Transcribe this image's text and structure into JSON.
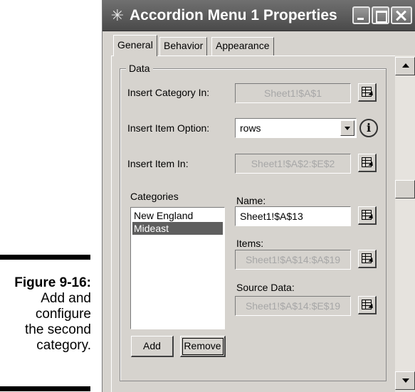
{
  "caption": {
    "figure": "Figure 9-16:",
    "lines": [
      "Add and",
      "configure",
      "the second",
      "category."
    ]
  },
  "window": {
    "title": "Accordion Menu 1 Properties",
    "controls": [
      "minimize-icon",
      "maximize-icon",
      "close-icon"
    ]
  },
  "tabs": [
    {
      "label": "General",
      "active": true
    },
    {
      "label": "Behavior",
      "active": false
    },
    {
      "label": "Appearance",
      "active": false
    }
  ],
  "data_group": {
    "legend": "Data",
    "insert_category_in": {
      "label": "Insert Category In:",
      "value": "Sheet1!$A$1"
    },
    "insert_item_option": {
      "label": "Insert Item Option:",
      "value": "rows"
    },
    "insert_item_in": {
      "label": "Insert Item In:",
      "value": "Sheet1!$A$2:$E$2"
    }
  },
  "categories": {
    "label": "Categories",
    "items": [
      {
        "label": "New England",
        "selected": false
      },
      {
        "label": "Mideast",
        "selected": true
      }
    ],
    "add_button": "Add",
    "remove_button": "Remove"
  },
  "details": {
    "name": {
      "label": "Name:",
      "value": "Sheet1!$A$13"
    },
    "items": {
      "label": "Items:",
      "value": "Sheet1!$A$14:$A$19"
    },
    "source_data": {
      "label": "Source Data:",
      "value": "Sheet1!$A$14:$E$19"
    }
  },
  "colors": {
    "dialog_face": "#d6d3ce",
    "titlebar": "#4a4a4a",
    "selection": "#5e5e5e",
    "disabled_text": "#a7a7a7"
  }
}
